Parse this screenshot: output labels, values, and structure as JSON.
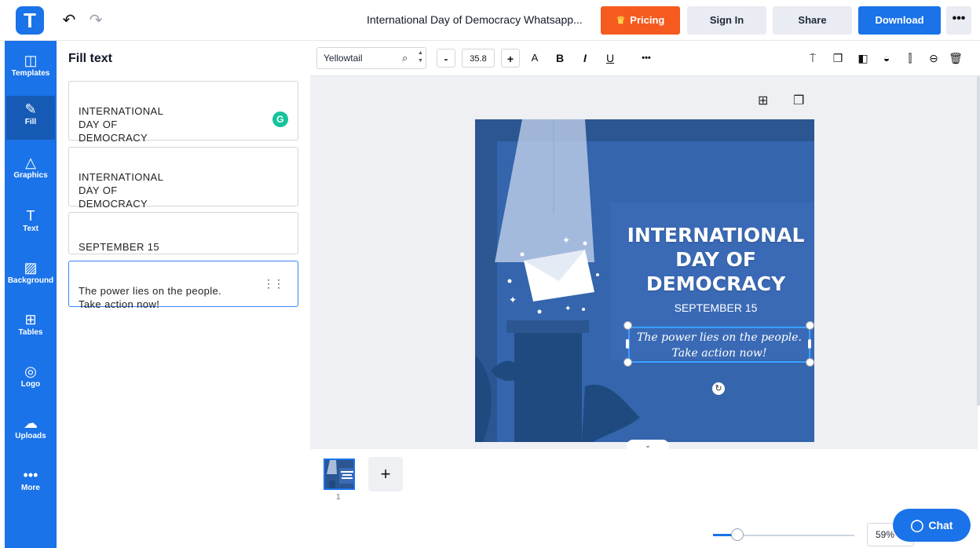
{
  "app": {
    "logo_letter": "T",
    "document_title": "International Day of Democracy Whatsapp..."
  },
  "header": {
    "undo_icon": "undo-icon",
    "redo_icon": "redo-icon",
    "pricing_label": "Pricing",
    "signin_label": "Sign In",
    "share_label": "Share",
    "download_label": "Download",
    "more_label": "•••"
  },
  "sidebar": {
    "items": [
      {
        "label": "Templates",
        "icon": "templates-icon",
        "glyph": "◫"
      },
      {
        "label": "Fill",
        "icon": "pencil-icon",
        "glyph": "✎"
      },
      {
        "label": "Graphics",
        "icon": "shapes-icon",
        "glyph": "△"
      },
      {
        "label": "Text",
        "icon": "text-icon",
        "glyph": "T"
      },
      {
        "label": "Background",
        "icon": "background-icon",
        "glyph": "▨"
      },
      {
        "label": "Tables",
        "icon": "table-icon",
        "glyph": "⊞"
      },
      {
        "label": "Logo",
        "icon": "logo-icon",
        "glyph": "◎"
      },
      {
        "label": "Uploads",
        "icon": "cloud-upload-icon",
        "glyph": "☁"
      },
      {
        "label": "More",
        "icon": "more-icon",
        "glyph": "•••"
      }
    ]
  },
  "panel": {
    "title": "Fill text",
    "fields": [
      "INTERNATIONAL\nDAY OF\nDEMOCRACY",
      "INTERNATIONAL\nDAY OF\nDEMOCRACY",
      "SEPTEMBER 15",
      "The power lies on the people.\nTake action now!"
    ]
  },
  "toolbar": {
    "font_name": "Yellowtail",
    "font_size": "35.8",
    "minus": "-",
    "plus": "+",
    "case": "A",
    "bold": "B",
    "italic": "I",
    "underline": "U",
    "more": "•••"
  },
  "design": {
    "title": "INTERNATIONAL\nDAY OF\nDEMOCRACY",
    "date": "SEPTEMBER 15",
    "quote": "The power lies on the people.\nTake action now!",
    "colors": {
      "bg": "#2b5691",
      "panel": "#3a6ab5",
      "accent": "#1a73e8",
      "pricing": "#f55b1f"
    }
  },
  "pages": {
    "current_page_number": "1",
    "add_label": "+"
  },
  "zoom": {
    "value": "59%",
    "level_fraction": 0.59
  },
  "chat": {
    "label": "Chat"
  }
}
